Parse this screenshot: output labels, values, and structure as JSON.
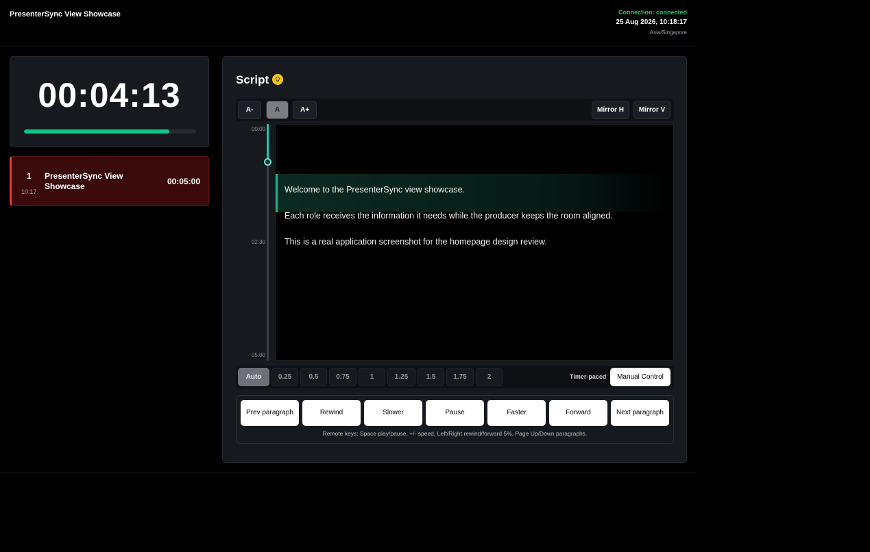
{
  "header": {
    "app_title": "PresenterSync View Showcase",
    "connection": "Connection: connected",
    "datetime": "25 Aug 2026, 10:18:17",
    "timezone": "Asia/Singapore"
  },
  "timer": {
    "value": "00:04:13",
    "progress_fraction": 0.845,
    "progress_color": "#10c587"
  },
  "segment": {
    "number": "1",
    "start_time": "10:17",
    "title": "PresenterSync View Showcase",
    "duration": "00:05:00",
    "accent_color": "#e53935"
  },
  "script": {
    "title": "Script",
    "hint_icon": "lightbulb-icon",
    "toolbar": {
      "font_smaller": "A-",
      "font_default": "A",
      "font_larger": "A+",
      "mirror_h": "Mirror H",
      "mirror_v": "Mirror V"
    },
    "timeline": {
      "start_label": "00:00",
      "mid_label": "02:30",
      "end_label": "05:00",
      "position_fraction": 0.16
    },
    "paragraphs": [
      "Welcome to the PresenterSync view showcase.",
      "Each role receives the information it needs while the producer keeps the room aligned.",
      "This is a real application screenshot for the homepage design review."
    ],
    "current_paragraph_index": 0
  },
  "speed": {
    "options": [
      "Auto",
      "0.25",
      "0.5",
      "0.75",
      "1",
      "1.25",
      "1.5",
      "1.75",
      "2"
    ],
    "selected": "Auto",
    "paced_label": "Timer-paced",
    "manual_label": "Manual Control"
  },
  "controls": {
    "buttons": [
      "Prev paragraph",
      "Rewind",
      "Slower",
      "Pause",
      "Faster",
      "Forward",
      "Next paragraph"
    ],
    "hint": "Remote keys: Space play/pause, +/- speed, Left/Right rewind/forward 5%, Page Up/Down paragraphs."
  }
}
